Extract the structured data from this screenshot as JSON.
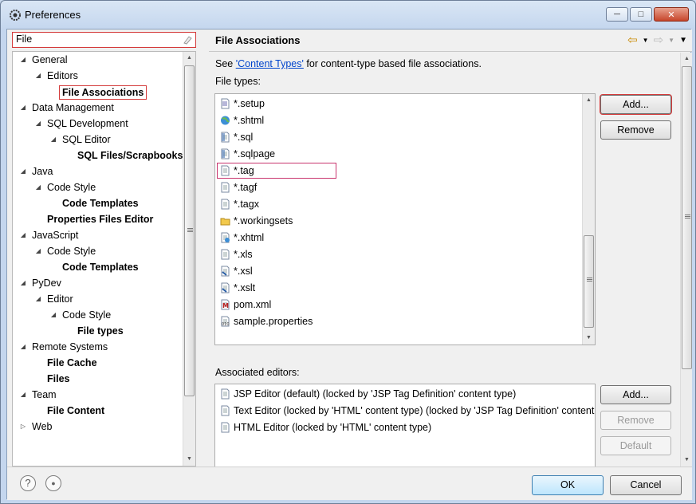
{
  "window": {
    "title": "Preferences"
  },
  "filter": {
    "value": "File"
  },
  "tree": [
    {
      "label": "General",
      "indent": 0,
      "twisty": "open",
      "bold": false
    },
    {
      "label": "Editors",
      "indent": 1,
      "twisty": "open",
      "bold": false
    },
    {
      "label": "File Associations",
      "indent": 2,
      "twisty": "",
      "bold": true,
      "selected": true
    },
    {
      "label": "Data Management",
      "indent": 0,
      "twisty": "open",
      "bold": false
    },
    {
      "label": "SQL Development",
      "indent": 1,
      "twisty": "open",
      "bold": false
    },
    {
      "label": "SQL Editor",
      "indent": 2,
      "twisty": "open",
      "bold": false
    },
    {
      "label": "SQL Files/Scrapbooks",
      "indent": 3,
      "twisty": "",
      "bold": true
    },
    {
      "label": "Java",
      "indent": 0,
      "twisty": "open",
      "bold": false
    },
    {
      "label": "Code Style",
      "indent": 1,
      "twisty": "open",
      "bold": false
    },
    {
      "label": "Code Templates",
      "indent": 2,
      "twisty": "",
      "bold": true
    },
    {
      "label": "Properties Files Editor",
      "indent": 1,
      "twisty": "",
      "bold": true
    },
    {
      "label": "JavaScript",
      "indent": 0,
      "twisty": "open",
      "bold": false
    },
    {
      "label": "Code Style",
      "indent": 1,
      "twisty": "open",
      "bold": false
    },
    {
      "label": "Code Templates",
      "indent": 2,
      "twisty": "",
      "bold": true
    },
    {
      "label": "PyDev",
      "indent": 0,
      "twisty": "open",
      "bold": false
    },
    {
      "label": "Editor",
      "indent": 1,
      "twisty": "open",
      "bold": false
    },
    {
      "label": "Code Style",
      "indent": 2,
      "twisty": "open",
      "bold": false
    },
    {
      "label": "File types",
      "indent": 3,
      "twisty": "",
      "bold": true
    },
    {
      "label": "Remote Systems",
      "indent": 0,
      "twisty": "open",
      "bold": false
    },
    {
      "label": "File Cache",
      "indent": 1,
      "twisty": "",
      "bold": true
    },
    {
      "label": "Files",
      "indent": 1,
      "twisty": "",
      "bold": true
    },
    {
      "label": "Team",
      "indent": 0,
      "twisty": "open",
      "bold": false
    },
    {
      "label": "File Content",
      "indent": 1,
      "twisty": "",
      "bold": true
    },
    {
      "label": "Web",
      "indent": 0,
      "twisty": "closed",
      "bold": false
    }
  ],
  "page": {
    "title": "File Associations",
    "see_prefix": "See ",
    "see_link": "'Content Types'",
    "see_suffix": " for content-type based file associations.",
    "file_types_label": "File types:",
    "associated_label": "Associated editors:"
  },
  "file_types": [
    {
      "name": "*.setup",
      "icon": "setup-file-icon"
    },
    {
      "name": "*.shtml",
      "icon": "globe-file-icon"
    },
    {
      "name": "*.sql",
      "icon": "sql-file-icon"
    },
    {
      "name": "*.sqlpage",
      "icon": "sql-file-icon"
    },
    {
      "name": "*.tag",
      "icon": "text-file-icon",
      "selected": true
    },
    {
      "name": "*.tagf",
      "icon": "text-file-icon"
    },
    {
      "name": "*.tagx",
      "icon": "text-file-icon"
    },
    {
      "name": "*.workingsets",
      "icon": "folder-file-icon"
    },
    {
      "name": "*.xhtml",
      "icon": "web-file-icon"
    },
    {
      "name": "*.xls",
      "icon": "text-file-icon"
    },
    {
      "name": "*.xsl",
      "icon": "xsl-file-icon"
    },
    {
      "name": "*.xslt",
      "icon": "xsl-file-icon"
    },
    {
      "name": "pom.xml",
      "icon": "maven-file-icon"
    },
    {
      "name": "sample.properties",
      "icon": "properties-file-icon"
    }
  ],
  "associated_editors": [
    {
      "name": "JSP Editor (default) (locked by 'JSP Tag Definition' content type)"
    },
    {
      "name": "Text Editor (locked by 'HTML' content type) (locked by 'JSP Tag Definition' content type)"
    },
    {
      "name": "HTML Editor (locked by 'HTML' content type)"
    }
  ],
  "buttons": {
    "add": "Add...",
    "remove": "Remove",
    "add_editor": "Add...",
    "remove_editor": "Remove",
    "default": "Default",
    "ok": "OK",
    "cancel": "Cancel",
    "help": "?"
  },
  "colors": {
    "highlight_red": "#d43b3b",
    "link": "#0044cc",
    "tag_selection": "#c9356e"
  }
}
